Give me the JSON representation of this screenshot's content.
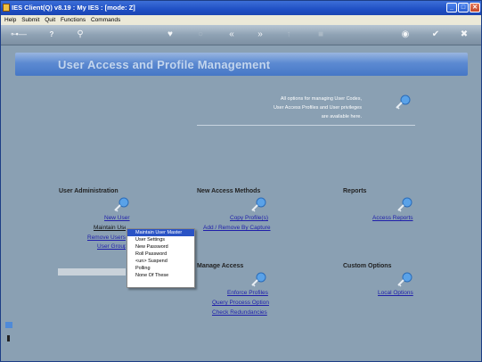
{
  "window": {
    "title": "IES Client(Q) v8.19 : My IES :      [mode: Z]"
  },
  "menubar": {
    "items": [
      "Help",
      "Submit",
      "Quit",
      "Functions",
      "Commands"
    ]
  },
  "toolbar": {
    "icons": [
      "key-icon",
      "help-icon",
      "search-icon",
      "heart-icon",
      "circle-icon",
      "back-icon",
      "forward-icon",
      "up-icon",
      "stop-icon",
      "globe-icon",
      "check-icon",
      "close-icon"
    ]
  },
  "banner": {
    "title": "User Access and Profile Management"
  },
  "info": {
    "line1": "All options for managing User Codes,",
    "line2": "User Access Profiles and User privileges",
    "line3": "are available here."
  },
  "sections": {
    "user_admin": {
      "title": "User Administration",
      "links": [
        "New User",
        "Maintain User",
        "Remove Users",
        "User Groups"
      ]
    },
    "new_access": {
      "title": "New Access Methods",
      "links": [
        "Copy Profile(s)",
        "Add / Remove By Capture"
      ]
    },
    "reports": {
      "title": "Reports",
      "links": [
        "Access Reports"
      ]
    },
    "manage_access": {
      "title": "Manage Access",
      "links": [
        "Enforce Profiles",
        "Query Process Option",
        "Check Redundancies"
      ]
    },
    "custom_options": {
      "title": "Custom Options",
      "links": [
        "Local Options"
      ]
    }
  },
  "context_menu": {
    "items": [
      "Maintain User Master",
      "User Settings",
      "New Password",
      "Roll Password",
      "<un> Suspend",
      "Polling",
      "None Of These"
    ],
    "highlighted": 0
  },
  "colors": {
    "link": "#1f1faa",
    "banner_text": "#c3d6ef",
    "menu_highlight": "#2a53c5"
  }
}
